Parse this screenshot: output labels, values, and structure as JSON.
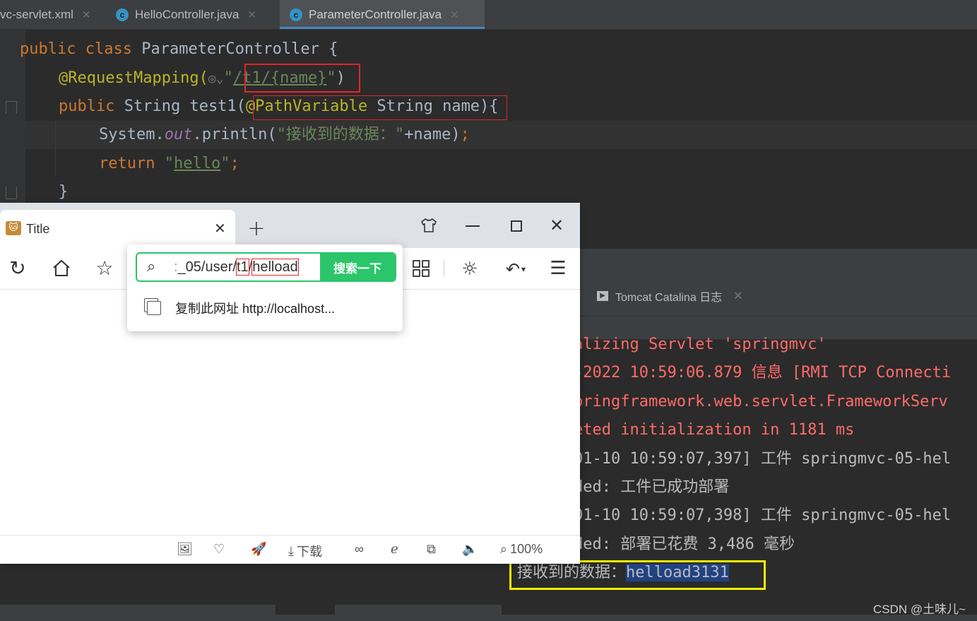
{
  "ide": {
    "tabs": [
      {
        "label": "vc-servlet.xml",
        "active": false
      },
      {
        "label": "HelloController.java",
        "active": false
      },
      {
        "label": "ParameterController.java",
        "active": true
      }
    ],
    "code": {
      "l1_public": "public",
      "l1_class": "class",
      "l1_name": "ParameterController {",
      "l2_annotation": "@RequestMapping(",
      "l2_path": "/t1/{name}",
      "l2_close": ")",
      "l3_public": "public",
      "l3_sig": "String test1(",
      "l3_param_ann": "@PathVariable",
      "l3_param": "String name",
      "l3_close": "){",
      "l4_system": "System.",
      "l4_out": "out",
      "l4_println": ".println(",
      "l4_string": "\"接收到的数据：\"",
      "l4_rest": "+name)",
      "l4_semi": ";",
      "l5_return": "return",
      "l5_str_q1": "\"",
      "l5_str": "hello",
      "l5_str_q2": "\"",
      "l5_semi": ";",
      "l6_brace": "}"
    }
  },
  "console": {
    "tab_label": "Tomcat Catalina 日志",
    "lines": [
      "alizing Servlet 'springmvc'",
      "-2022 10:59:06.879 信息 [RMI TCP Connecti",
      "pringframework.web.servlet.FrameworkServ",
      "eted initialization in 1181 ms",
      "01-10 10:59:07,397] 工件 springmvc-05-hel",
      "ded: 工件已成功部署",
      "01-10 10:59:07,398] 工件 springmvc-05-hel",
      "ded: 部署已花费 3,486 毫秒"
    ],
    "output_prefix": "接收到的数据：",
    "output_value": "helload3131"
  },
  "browser": {
    "tab_title": "Title",
    "address_pre": "_05/user/",
    "address_seg1": "t1",
    "address_slash": "/",
    "address_seg2": "helload",
    "search_button": "搜索一下",
    "popup_item": "复制此网址 http://localhost...",
    "status": {
      "download_label": "下载",
      "zoom": "100%"
    }
  },
  "watermark": "CSDN @土味儿~",
  "colors": {
    "accent_green": "#2bc56b",
    "highlight_red": "#e0262d",
    "highlight_yellow": "#f4f000",
    "selection_blue": "#214283"
  }
}
